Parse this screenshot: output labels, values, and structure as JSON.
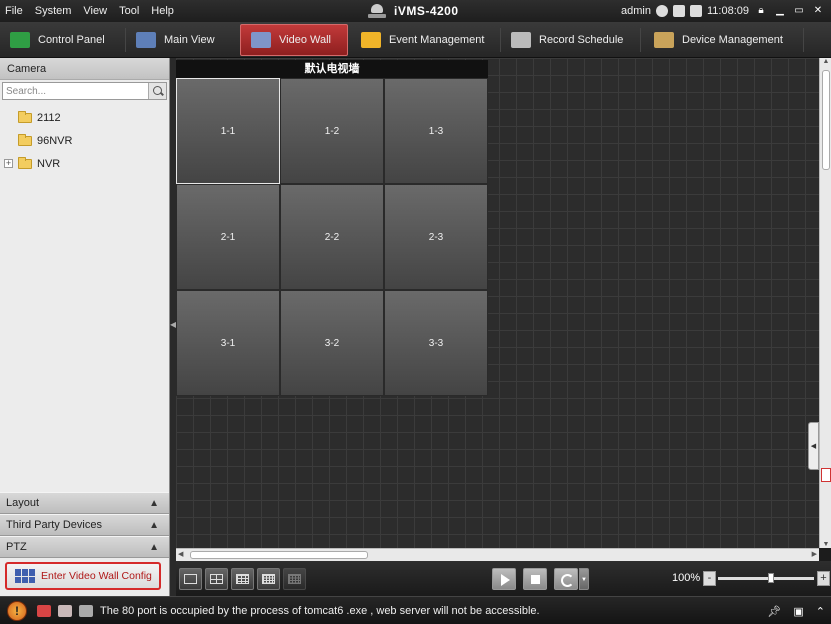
{
  "menu": [
    "File",
    "System",
    "View",
    "Tool",
    "Help"
  ],
  "app_title": "iVMS-4200",
  "header_right": {
    "user": "admin",
    "time": "11:08:09"
  },
  "tabs": [
    {
      "label": "Control Panel",
      "icon": "control-panel-icon",
      "color": "#2f9e44"
    },
    {
      "label": "Main View",
      "icon": "main-view-icon",
      "color": "#5e7fb8"
    },
    {
      "label": "Video Wall",
      "icon": "video-wall-icon",
      "color": "#7f95c9"
    },
    {
      "label": "Event Management",
      "icon": "event-management-icon",
      "color": "#f0b429"
    },
    {
      "label": "Record Schedule",
      "icon": "record-schedule-icon",
      "color": "#bbbbbb"
    },
    {
      "label": "Device Management",
      "icon": "device-management-icon",
      "color": "#c9a35a"
    }
  ],
  "active_tab": "Video Wall",
  "left_panel": {
    "header": "Camera",
    "search_placeholder": "Search...",
    "tree": [
      {
        "label": "2112",
        "expandable": false
      },
      {
        "label": "96NVR",
        "expandable": false
      },
      {
        "label": "NVR",
        "expandable": true
      }
    ],
    "sections": [
      "Layout",
      "Third Party Devices",
      "PTZ"
    ],
    "config_button": "Enter Video Wall Config"
  },
  "video_wall": {
    "title": "默认电视墙",
    "cells": [
      "1-1",
      "1-2",
      "1-3",
      "2-1",
      "2-2",
      "2-3",
      "3-1",
      "3-2",
      "3-3"
    ],
    "selected_cell": "1-1"
  },
  "toolbar": {
    "zoom": "100%",
    "zoom_minus": "-",
    "zoom_plus": "+",
    "zoom_level": 0.55
  },
  "status": {
    "message": "The 80 port is occupied by the process of tomcat6 .exe , web server will not be accessible."
  },
  "colors": {
    "accent": "#c23a3a",
    "config_border": "#d52a2a"
  }
}
